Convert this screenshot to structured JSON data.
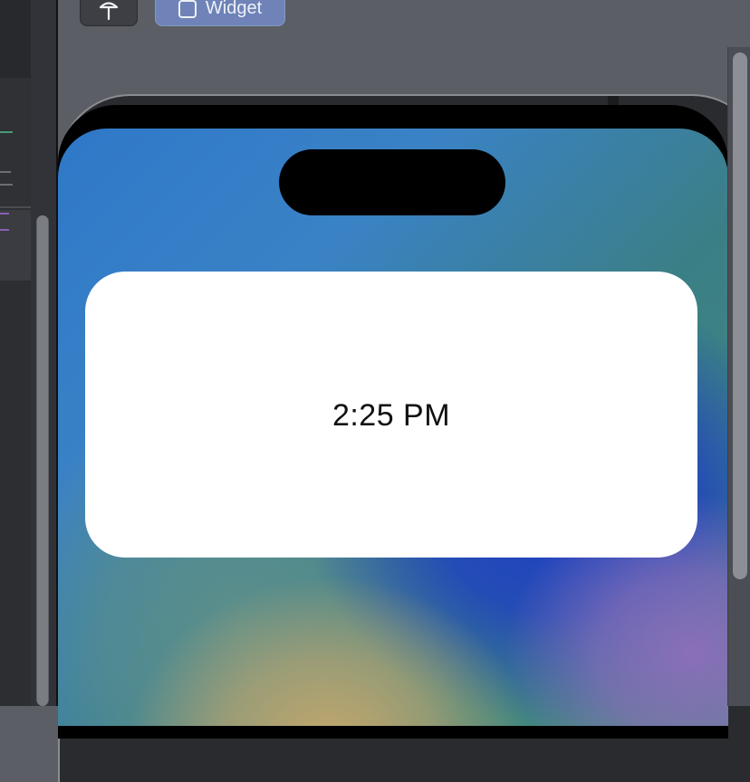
{
  "toolbar": {
    "pin_icon_name": "pin-icon",
    "widget_icon_name": "widget-square-icon",
    "widget_label": "Widget"
  },
  "preview": {
    "widget": {
      "time": "2:25 PM"
    }
  },
  "colors": {
    "canvas_bg": "#5b5e64",
    "widget_button_bg": "#6f83b8",
    "widget_card_bg": "#ffffff",
    "editor_accent_green": "#4a9a7a",
    "editor_accent_purple": "#8a5fb0"
  }
}
